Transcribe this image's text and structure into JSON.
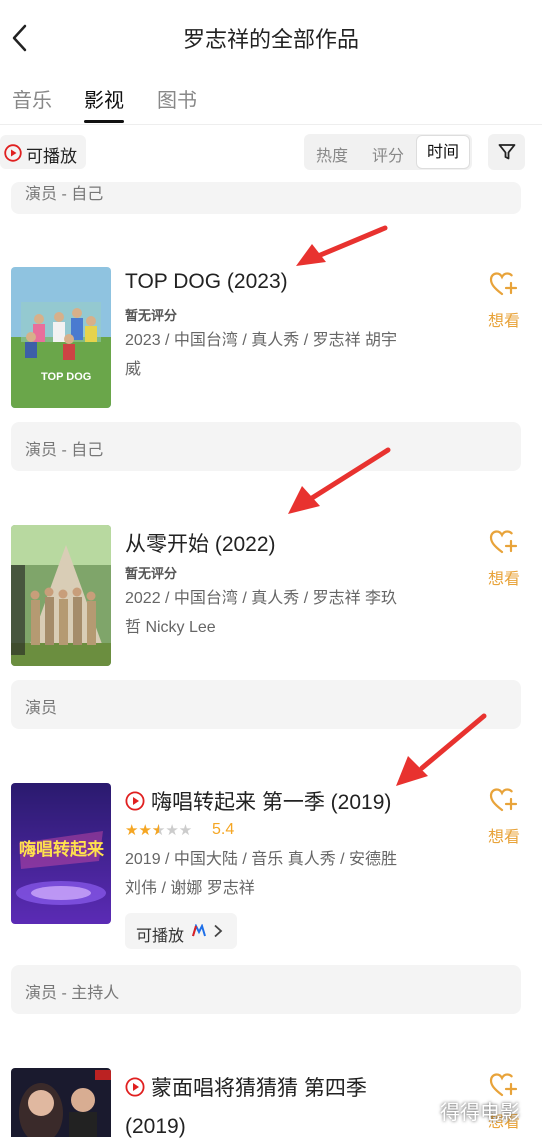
{
  "header": {
    "title": "罗志祥的全部作品"
  },
  "tabs": [
    {
      "label": "音乐"
    },
    {
      "label": "影视"
    },
    {
      "label": "图书"
    }
  ],
  "filters": {
    "playable_label": "可播放",
    "sort": [
      {
        "label": "热度"
      },
      {
        "label": "评分"
      },
      {
        "label": "时间"
      }
    ],
    "active_sort": "时间"
  },
  "top_role": "演员 - 自己",
  "works": [
    {
      "title": "TOP DOG (2023)",
      "rating_text": "暂无评分",
      "meta_line1": "2023 / 中国台湾 / 真人秀 / 罗志祥 胡宇",
      "meta_line2": "威",
      "want_label": "想看",
      "role": "演员 - 自己",
      "poster_text": "TOP DOG"
    },
    {
      "title": "从零开始 (2022)",
      "rating_text": "暂无评分",
      "meta_line1": "2022 / 中国台湾 / 真人秀 / 罗志祥 李玖",
      "meta_line2": "哲 Nicky Lee",
      "want_label": "想看",
      "role": "演员"
    },
    {
      "title": "嗨唱转起来 第一季 (2019)",
      "rating": 5.4,
      "rating_text": "5.4",
      "stars_full": 2,
      "stars_half": 1,
      "meta_line1": "2019 / 中国大陆 / 音乐 真人秀 / 安德胜",
      "meta_line2": "刘伟 / 谢娜 罗志祥",
      "available_label": "可播放",
      "want_label": "想看",
      "role": "演员 - 主持人",
      "poster_text": "嗨唱转起来"
    },
    {
      "title_line1": "蒙面唱将猜猜猜 第四季",
      "title_line2": "(2019)",
      "want_label": "想看"
    }
  ],
  "watermark": "得得电影",
  "colors": {
    "accent": "#e8a33a",
    "play_red": "#e02020",
    "arrow_red": "#e8322f",
    "star": "#f5a623"
  }
}
